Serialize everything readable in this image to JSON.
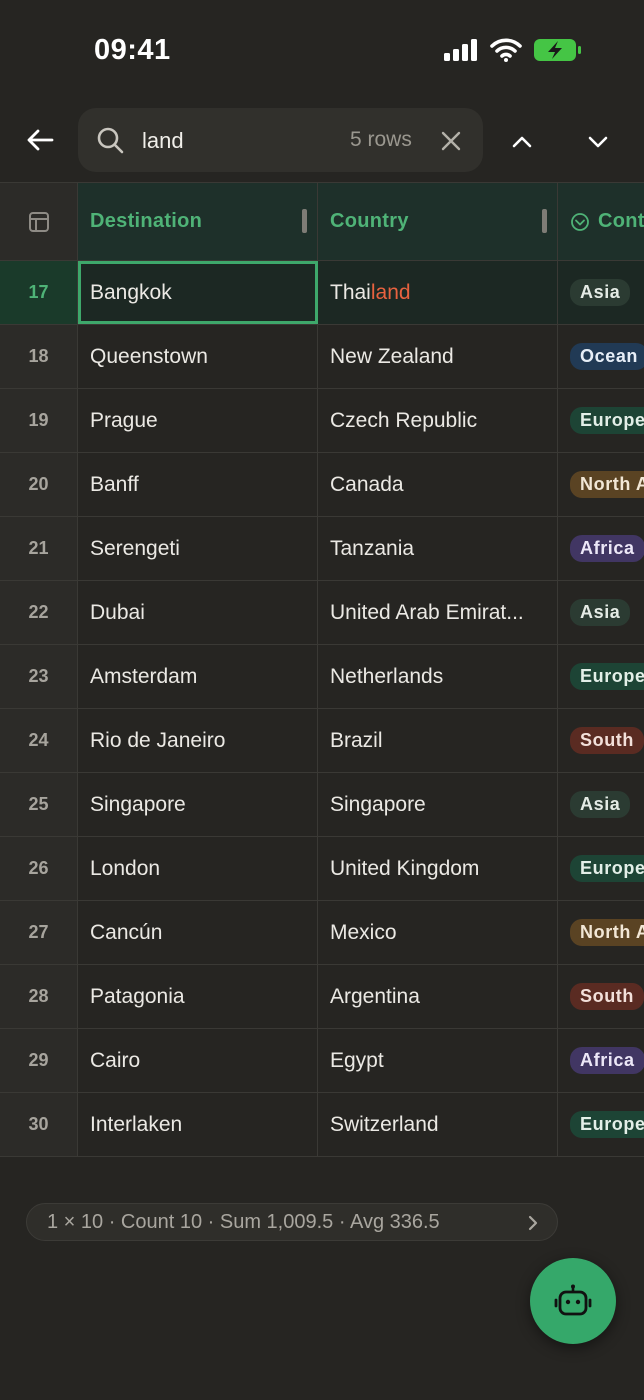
{
  "status_bar": {
    "time": "09:41"
  },
  "search": {
    "query": "land",
    "placeholder": "",
    "results": "5 rows"
  },
  "table": {
    "headers": {
      "destination": "Destination",
      "country": "Country",
      "continent": "Cont"
    },
    "selected_row": "17",
    "rows": [
      {
        "num": "17",
        "destination": "Bangkok",
        "country_pre": "Thai",
        "country_match": "land",
        "continent": "Asia",
        "tag": "asia"
      },
      {
        "num": "18",
        "destination": "Queenstown",
        "country": "New Zealand",
        "continent": "Ocean",
        "tag": "oceania"
      },
      {
        "num": "19",
        "destination": "Prague",
        "country": "Czech Republic",
        "continent": "Europe",
        "tag": "europe"
      },
      {
        "num": "20",
        "destination": "Banff",
        "country": "Canada",
        "continent": "North A",
        "tag": "north"
      },
      {
        "num": "21",
        "destination": "Serengeti",
        "country": "Tanzania",
        "continent": "Africa",
        "tag": "africa"
      },
      {
        "num": "22",
        "destination": "Dubai",
        "country": "United Arab Emirat...",
        "continent": "Asia",
        "tag": "asia"
      },
      {
        "num": "23",
        "destination": "Amsterdam",
        "country": "Netherlands",
        "continent": "Europe",
        "tag": "europe"
      },
      {
        "num": "24",
        "destination": "Rio de Janeiro",
        "country": "Brazil",
        "continent": "South",
        "tag": "south"
      },
      {
        "num": "25",
        "destination": "Singapore",
        "country": "Singapore",
        "continent": "Asia",
        "tag": "asia"
      },
      {
        "num": "26",
        "destination": "London",
        "country": "United Kingdom",
        "continent": "Europe",
        "tag": "europe"
      },
      {
        "num": "27",
        "destination": "Cancún",
        "country": "Mexico",
        "continent": "North A",
        "tag": "north"
      },
      {
        "num": "28",
        "destination": "Patagonia",
        "country": "Argentina",
        "continent": "South",
        "tag": "south"
      },
      {
        "num": "29",
        "destination": "Cairo",
        "country": "Egypt",
        "continent": "Africa",
        "tag": "africa"
      },
      {
        "num": "30",
        "destination": "Interlaken",
        "country": "Switzerland",
        "continent": "Europe",
        "tag": "europe"
      }
    ]
  },
  "summary": {
    "text": "1 × 10 · Count 10 · Sum 1,009.5 · Avg 336.5"
  },
  "colors": {
    "accent": "#35a86a",
    "highlight": "#e8623f",
    "background": "#262522",
    "header_bg": "#1e302a"
  },
  "icons": [
    "back-arrow-icon",
    "search-icon",
    "close-icon",
    "chevron-up-icon",
    "chevron-down-icon",
    "table-icon",
    "chevron-circle-down-icon",
    "chevron-right-icon",
    "robot-icon",
    "signal-icon",
    "wifi-icon",
    "battery-charging-icon"
  ]
}
